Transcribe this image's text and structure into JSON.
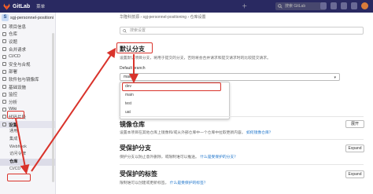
{
  "topbar": {
    "brand": "GitLab",
    "menu_label": "菜单",
    "search_placeholder": "搜索 GitLab"
  },
  "sidebar": {
    "project_initial": "S",
    "project_name": "sgj-personnel-positioni",
    "items": [
      {
        "label": "项目信息"
      },
      {
        "label": "仓库"
      },
      {
        "label": "议题"
      },
      {
        "label": "合并请求"
      },
      {
        "label": "CI/CD"
      },
      {
        "label": "安全与合规"
      },
      {
        "label": "部署"
      },
      {
        "label": "软件包与镜像库"
      },
      {
        "label": "基础设施"
      },
      {
        "label": "监控"
      },
      {
        "label": "分析"
      },
      {
        "label": "Wiki"
      },
      {
        "label": "代码片段"
      },
      {
        "label": "设置"
      }
    ],
    "settings_sub": [
      {
        "label": "通用"
      },
      {
        "label": "集成"
      },
      {
        "label": "Webhook"
      },
      {
        "label": "访问令牌"
      },
      {
        "label": "仓库"
      },
      {
        "label": "CI/CD"
      }
    ]
  },
  "breadcrumb": "华隆科技源 › sgj-personnel-positioning › 仓库设置",
  "search": {
    "placeholder": "搜索设置"
  },
  "default_branch": {
    "title": "默认分支",
    "desc": "设置默认项目分支，将用于提交的分支，否则将会合并请求和提交请求时的比较提交请求。",
    "field_label": "Default branch",
    "selected": "main",
    "options": [
      "dev",
      "main",
      "test",
      "uat"
    ]
  },
  "mirror": {
    "title": "镜像仓库",
    "desc": "设置本项目在其他仓库上镜像和/或从外部仓库中一个仓库中拉取更新内容。",
    "link": "如何镜像仓库？",
    "button": "展开"
  },
  "protected_branches": {
    "title": "受保护分支",
    "desc": "保护分支以防止意外删除，或限制谁可以推送。",
    "link": "什么是受保护的分支？",
    "button": "Expand"
  },
  "protected_tags": {
    "title": "受保护的标签",
    "desc": "限制谁可以创建或更新标签。",
    "link": "什么是受保护的标签？",
    "button": "Expand"
  },
  "colors": {
    "topbar": "#292961",
    "highlight": "#d9332b",
    "link": "#1f75cb"
  }
}
